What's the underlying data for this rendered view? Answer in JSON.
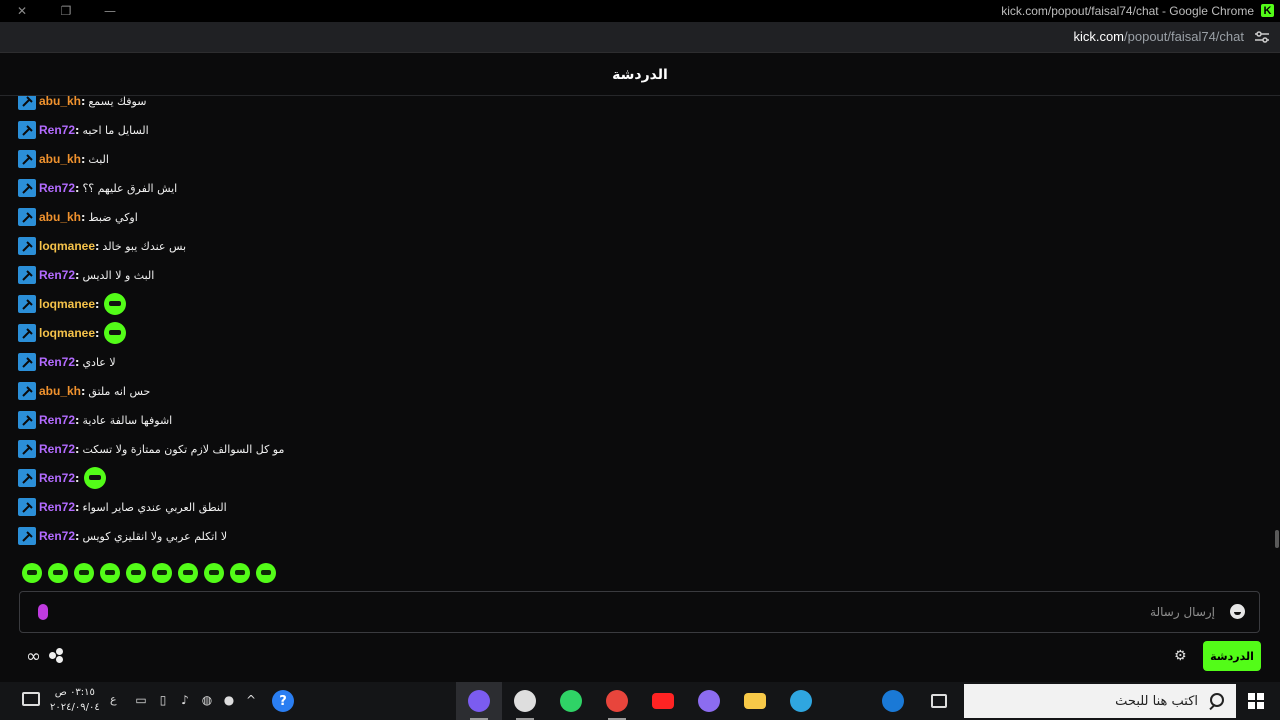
{
  "browser": {
    "window_title": "kick.com/popout/faisal74/chat - Google Chrome",
    "url_domain": "kick.com",
    "url_path": "/popout/faisal74/chat",
    "controls": {
      "close": "✕",
      "restore": "❐",
      "minimize": "—"
    },
    "logo_letter": "K"
  },
  "chat": {
    "header_title": "الدردشة",
    "messages": [
      {
        "user": "abu_kh",
        "color": "#f0922e",
        "text": "سوفك يسمع",
        "emote": false
      },
      {
        "user": "Ren72",
        "color": "#b36bff",
        "text": "السايل ما احبه",
        "emote": false
      },
      {
        "user": "abu_kh",
        "color": "#f0922e",
        "text": "البث",
        "emote": false
      },
      {
        "user": "Ren72",
        "color": "#b36bff",
        "text": "ايش الفرق عليهم ؟؟",
        "emote": false
      },
      {
        "user": "abu_kh",
        "color": "#f0922e",
        "text": "اوكي ضبط",
        "emote": false
      },
      {
        "user": "loqmanee",
        "color": "#f5c24a",
        "text": "بس عندك يبو خالد",
        "emote": false
      },
      {
        "user": "Ren72",
        "color": "#b36bff",
        "text": "البث و لا الديس",
        "emote": false
      },
      {
        "user": "loqmanee",
        "color": "#f5c24a",
        "text": "",
        "emote": true
      },
      {
        "user": "loqmanee",
        "color": "#f5c24a",
        "text": "",
        "emote": true
      },
      {
        "user": "Ren72",
        "color": "#b36bff",
        "text": "لا عادي",
        "emote": false
      },
      {
        "user": "abu_kh",
        "color": "#f0922e",
        "text": "حس انه ملتق",
        "emote": false
      },
      {
        "user": "Ren72",
        "color": "#b36bff",
        "text": "اشوفها سالفة عادية",
        "emote": false
      },
      {
        "user": "Ren72",
        "color": "#b36bff",
        "text": "مو كل السوالف لازم تكون ممتازة ولا تسكت",
        "emote": false
      },
      {
        "user": "Ren72",
        "color": "#b36bff",
        "text": "",
        "emote": true
      },
      {
        "user": "Ren72",
        "color": "#b36bff",
        "text": "النطق العربي عندي صاير اسواء",
        "emote": false
      },
      {
        "user": "Ren72",
        "color": "#b36bff",
        "text": "لا اتكلم عربي ولا انقليزي كويس",
        "emote": false
      }
    ],
    "quick_emotes_count": 10,
    "input_placeholder": "إرسال رسالة",
    "send_button_label": "الدردشة",
    "accent_color": "#53fc18"
  },
  "taskbar": {
    "time": "٠٣:١٥ ص",
    "date": "٢٠٢٤/٠٩/٠٤",
    "language": "ع",
    "search_placeholder": "اكتب هنا للبحث",
    "help_label": "?",
    "apps": [
      {
        "name": "messenger",
        "color": "#7b5cf0",
        "state": "active"
      },
      {
        "name": "obs",
        "color": "#dedede",
        "state": "running"
      },
      {
        "name": "whatsapp",
        "color": "#2fd366",
        "state": "normal"
      },
      {
        "name": "chrome",
        "color": "#e8453c",
        "state": "running"
      },
      {
        "name": "youtube",
        "color": "#ff2323",
        "state": "normal"
      },
      {
        "name": "microsoft-365",
        "color": "#8c6cf0",
        "state": "normal"
      },
      {
        "name": "file-explorer",
        "color": "#f7c948",
        "state": "normal"
      },
      {
        "name": "edge",
        "color": "#2fa6e0",
        "state": "normal"
      },
      {
        "name": "spacer",
        "color": "transparent",
        "state": "normal"
      },
      {
        "name": "outlook",
        "color": "#1a79d6",
        "state": "normal"
      },
      {
        "name": "task-view",
        "color": "transparent",
        "state": "normal"
      }
    ]
  }
}
